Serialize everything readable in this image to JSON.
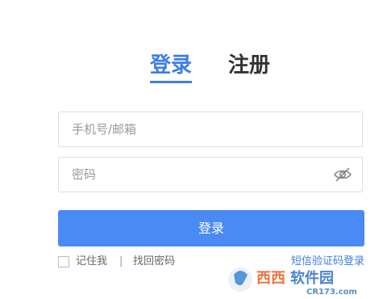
{
  "tabs": {
    "login": "登录",
    "register": "注册"
  },
  "form": {
    "phone_placeholder": "手机号/邮箱",
    "password_placeholder": "密码",
    "login_button": "登录"
  },
  "options": {
    "remember_label": "记住我",
    "separator": "|",
    "forgot_label": "找回密码",
    "sms_login_label": "短信验证码登录"
  },
  "icons": {
    "password_toggle": "eye-slash-icon"
  },
  "watermark": {
    "brand": "西西软件园",
    "url": "CR173.com"
  },
  "colors": {
    "accent": "#3d7ee6",
    "button": "#4a8af4"
  }
}
